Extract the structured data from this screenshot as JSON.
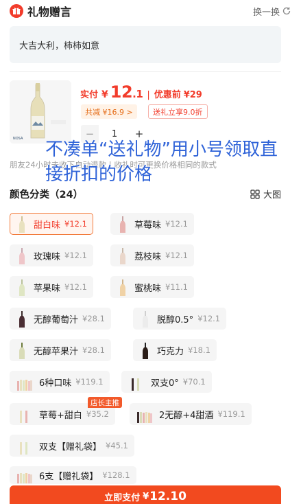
{
  "header": {
    "title": "礼物赠言",
    "swap_label": "换一换"
  },
  "message": {
    "text": "大吉大利，柿柿如意"
  },
  "product": {
    "price_label": "实付",
    "currency": "¥",
    "price_int": "12",
    "price_dec": ".1",
    "separator": "|",
    "orig_label": "优惠前",
    "orig_price": "¥29",
    "discount_tag": "共减 ¥16.9 >",
    "send_tag": "送礼立享9.0折",
    "quantity": "1",
    "minus": "−",
    "plus": "+"
  },
  "promo_overlay": "不凑单“送礼物”用小号领取直接折扣的价格",
  "notice": "朋友24小时未收下自动退款 | 收礼时可更换价格相同的款式",
  "options_section": {
    "title": "颜色分类（24）",
    "bigpic_label": "大图"
  },
  "options": [
    {
      "name": "甜白味",
      "price": "¥12.1",
      "selected": true
    },
    {
      "name": "草莓味",
      "price": "¥12.1"
    },
    {
      "name": "玫瑰味",
      "price": "¥12.1"
    },
    {
      "name": "荔枝味",
      "price": "¥12.1"
    },
    {
      "name": "苹果味",
      "price": "¥12.1"
    },
    {
      "name": "蜜桃味",
      "price": "¥11.1"
    },
    {
      "name": "无醇葡萄汁",
      "price": "¥28.1"
    },
    {
      "name": "脱醇0.5°",
      "price": "¥12.1"
    },
    {
      "name": "无醇苹果汁",
      "price": "¥28.1"
    },
    {
      "name": "巧克力",
      "price": "¥18.1"
    },
    {
      "name": "6种口味",
      "price": "¥119.1"
    },
    {
      "name": "双支0°",
      "price": "¥70.1"
    },
    {
      "name": "草莓+甜白",
      "price": "¥35.2"
    },
    {
      "name": "2无醇+4甜酒",
      "price": "¥119.1"
    },
    {
      "name": "双支【赠礼袋】",
      "price": "¥45.1"
    },
    {
      "name": "6支【赠礼袋】",
      "price": "¥128.1"
    }
  ],
  "badge": "店长主推",
  "pay_bar": {
    "label": "立即支付",
    "currency": "¥",
    "amount": "12.10"
  },
  "colors": {
    "accent": "#f23c2b",
    "pay": "#f24a1f",
    "overlay_text": "#2f63d8"
  }
}
